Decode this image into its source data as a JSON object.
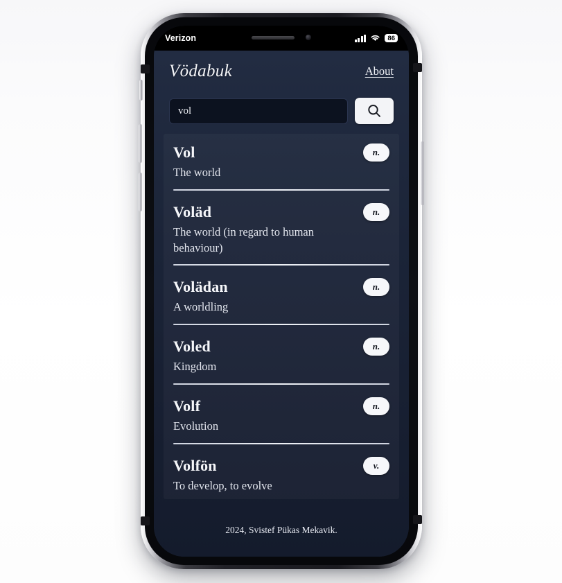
{
  "status_bar": {
    "carrier": "Verizon",
    "signal_icon": "cellular-signal-icon",
    "wifi_icon": "wifi-icon",
    "battery_level": "86"
  },
  "app": {
    "brand": "Vödabuk",
    "about_label": "About",
    "search": {
      "value": "vol",
      "placeholder": "Search",
      "button_icon": "search-icon"
    },
    "entries": [
      {
        "word": "Vol",
        "pos": "n.",
        "definition": "The world"
      },
      {
        "word": "Voläd",
        "pos": "n.",
        "definition": "The world (in regard to human behaviour)"
      },
      {
        "word": "Volädan",
        "pos": "n.",
        "definition": "A worldling"
      },
      {
        "word": "Voled",
        "pos": "n.",
        "definition": "Kingdom"
      },
      {
        "word": "Volf",
        "pos": "n.",
        "definition": "Evolution"
      },
      {
        "word": "Volfön",
        "pos": "v.",
        "definition": "To develop, to evolve"
      }
    ],
    "footer": "2024, Svistef Pükas Mekavik."
  },
  "colors": {
    "app_background": "#1b2438",
    "input_background": "#0c121f",
    "accent_light": "#f6f7fa",
    "text_primary": "#f5f6f9"
  }
}
